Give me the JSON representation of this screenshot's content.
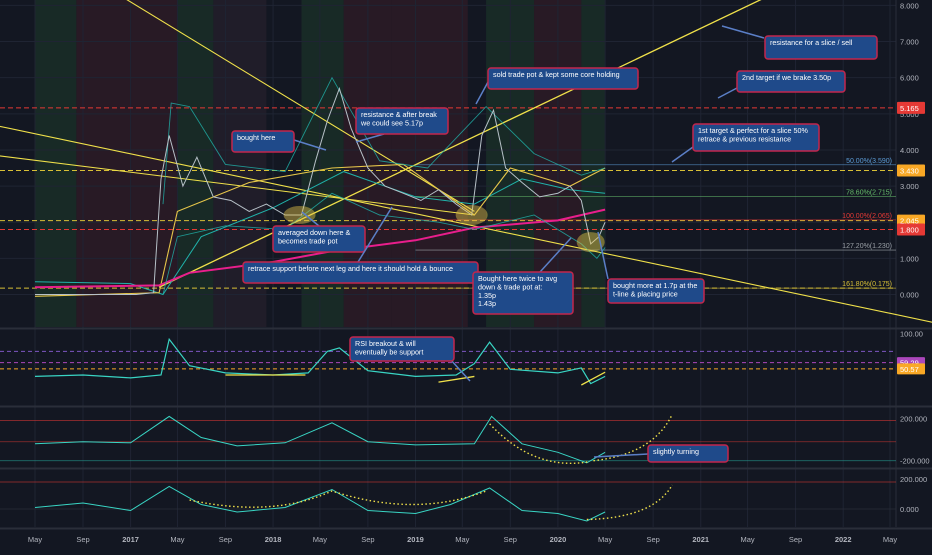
{
  "colors": {
    "background": "#131722",
    "grid": "#1f2433",
    "axis_text": "#b2b5be",
    "price_line": "#b7c1c8",
    "bollinger": "#20b2aa",
    "ma_fast": "#e6c64a",
    "ma_slow": "#e91e8c",
    "trendline": "#f0e14a",
    "level_line": "#d8c036",
    "red_level": "#e53935",
    "note_fill": "#1f4a8a",
    "note_border": "#c3264c",
    "note_text": "#ffffff",
    "oscillator": "#39d5c4",
    "hist_up": "#26a69a",
    "hist_down": "#ef5350"
  },
  "chart_data": [
    {
      "type": "line",
      "panel": "price",
      "y_axis_ticks": [
        "8.000",
        "7.000",
        "6.000",
        "5.000",
        "4.000",
        "3.000",
        "2.000",
        "1.000",
        "0.000"
      ],
      "ylim": [
        -0.9,
        8.15
      ],
      "series": [
        {
          "x": [
            "2016-05-01",
            "2016-08-01",
            "2016-11-01",
            "2017-01-15",
            "2017-03-01",
            "2017-03-20",
            "2017-04-10",
            "2017-05-15",
            "2017-06-20",
            "2017-08-01",
            "2017-09-15",
            "2017-11-01",
            "2017-12-15",
            "2018-02-01",
            "2018-03-15",
            "2018-04-20",
            "2018-05-20",
            "2018-06-20",
            "2018-07-20",
            "2018-09-01",
            "2018-10-15",
            "2018-12-01",
            "2019-01-15",
            "2019-03-01",
            "2019-04-15",
            "2019-05-25",
            "2019-06-20",
            "2019-07-20",
            "2019-08-20",
            "2019-10-01",
            "2019-11-15",
            "2020-01-01",
            "2020-02-01",
            "2020-03-01",
            "2020-03-25",
            "2020-04-15",
            "2020-05-01"
          ],
          "y": [
            0.0,
            0.0,
            0.0,
            0.0,
            0.05,
            3.2,
            4.4,
            3.0,
            3.8,
            2.7,
            2.6,
            2.3,
            2.5,
            2.2,
            2.2,
            3.7,
            4.8,
            5.7,
            4.6,
            3.5,
            3.0,
            2.8,
            2.6,
            2.9,
            2.5,
            2.2,
            4.4,
            5.1,
            3.5,
            3.1,
            2.7,
            2.8,
            3.0,
            2.6,
            1.4,
            1.6,
            2.0
          ]
        }
      ],
      "horizontal_levels": [
        {
          "name": "5.165",
          "value": 5.165,
          "color": "#e53935"
        },
        {
          "name": "3.430",
          "value": 3.43,
          "color": "#d8c036"
        },
        {
          "name": "2.045",
          "value": 2.045,
          "color": "#d8c036"
        },
        {
          "name": "1.800",
          "value": 1.8,
          "color": "#e53935"
        },
        {
          "name": "0.175",
          "value": 0.175,
          "color": "#d8c036"
        }
      ],
      "price_tags": [
        {
          "label": "5.165",
          "value": 5.165,
          "color": "#e53935"
        },
        {
          "label": "3.430",
          "value": 3.43,
          "color": "#f9a825"
        },
        {
          "label": "2.045",
          "value": 2.045,
          "color": "#f9a825"
        },
        {
          "label": "1.800",
          "value": 1.8,
          "color": "#e53935"
        }
      ],
      "fib_labels": [
        {
          "label": "50.00%(3.590)",
          "value": 3.59,
          "color": "#5b9bd5"
        },
        {
          "label": "78.60%(2.715)",
          "value": 2.715,
          "color": "#66bb6a"
        },
        {
          "label": "100.00%(2.065)",
          "value": 2.065,
          "color": "#e53935"
        },
        {
          "label": "127.20%(1.230)",
          "value": 1.23,
          "color": "#9aa0a6"
        },
        {
          "label": "161.80%(0.175)",
          "value": 0.175,
          "color": "#d8c036"
        }
      ]
    },
    {
      "type": "line",
      "panel": "rsi",
      "y_axis_ticks": [
        "100.00",
        "59.29",
        "50.57"
      ],
      "tags": [
        {
          "label": "59.29",
          "value": 59.29,
          "color": "#ab47bc"
        },
        {
          "label": "50.57",
          "value": 50.57,
          "color": "#f9a825"
        }
      ],
      "ylim": [
        0,
        105
      ],
      "series": [
        {
          "x": [
            "2016-05-01",
            "2016-09-01",
            "2017-01-01",
            "2017-03-20",
            "2017-04-10",
            "2017-06-01",
            "2017-09-01",
            "2018-01-01",
            "2018-04-01",
            "2018-05-20",
            "2018-06-20",
            "2018-09-01",
            "2019-01-01",
            "2019-04-15",
            "2019-06-01",
            "2019-07-10",
            "2019-09-01",
            "2020-01-01",
            "2020-03-01",
            "2020-03-25",
            "2020-05-01"
          ],
          "y": [
            40,
            42,
            38,
            42,
            92,
            55,
            45,
            42,
            45,
            75,
            80,
            48,
            40,
            42,
            58,
            88,
            50,
            45,
            52,
            30,
            40
          ]
        }
      ]
    },
    {
      "type": "bar",
      "panel": "momentum",
      "y_axis_ticks": [
        "200.000",
        "-200.000"
      ],
      "ylim": [
        -260,
        300
      ]
    },
    {
      "type": "area",
      "panel": "oscillator",
      "y_axis_ticks": [
        "200.000",
        "0.000"
      ],
      "ylim": [
        -120,
        260
      ]
    }
  ],
  "x_axis": {
    "ticks": [
      {
        "label": "May",
        "date": "2016-05-01"
      },
      {
        "label": "Sep",
        "date": "2016-09-01"
      },
      {
        "label": "2017",
        "date": "2017-01-01"
      },
      {
        "label": "May",
        "date": "2017-05-01"
      },
      {
        "label": "Sep",
        "date": "2017-09-01"
      },
      {
        "label": "2018",
        "date": "2018-01-01"
      },
      {
        "label": "May",
        "date": "2018-05-01"
      },
      {
        "label": "Sep",
        "date": "2018-09-01"
      },
      {
        "label": "2019",
        "date": "2019-01-01"
      },
      {
        "label": "May",
        "date": "2019-05-01"
      },
      {
        "label": "Sep",
        "date": "2019-09-01"
      },
      {
        "label": "2020",
        "date": "2020-01-01"
      },
      {
        "label": "May",
        "date": "2020-05-01"
      },
      {
        "label": "Sep",
        "date": "2020-09-01"
      },
      {
        "label": "2021",
        "date": "2021-01-01"
      },
      {
        "label": "May",
        "date": "2021-05-01"
      },
      {
        "label": "Sep",
        "date": "2021-09-01"
      },
      {
        "label": "2022",
        "date": "2022-01-01"
      },
      {
        "label": "May",
        "date": "2022-05-01"
      }
    ]
  },
  "annotations": [
    {
      "id": "resistance-slice",
      "text": [
        "resistance for a slice / sell"
      ]
    },
    {
      "id": "sold-trade-pot",
      "text": [
        "sold trade pot & kept some core holding"
      ]
    },
    {
      "id": "second-target",
      "text": [
        "2nd target if we brake 3.50p"
      ]
    },
    {
      "id": "resistance-break",
      "text": [
        "resistance & after break",
        "we could see 5.17p"
      ]
    },
    {
      "id": "bought-here",
      "text": [
        "bought here"
      ]
    },
    {
      "id": "first-target",
      "text": [
        "1st target & perfect for a slice 50%",
        "retrace & previous resistance"
      ]
    },
    {
      "id": "averaged-down",
      "text": [
        "averaged down here &",
        "becomes trade pot"
      ]
    },
    {
      "id": "retrace-support",
      "text": [
        "retrace support before next leg and here it should hold & bounce"
      ]
    },
    {
      "id": "bought-twice",
      "text": [
        "Bought here twice to avg",
        "down & trade pot at:",
        "1.35p",
        "1.43p"
      ]
    },
    {
      "id": "bought-more",
      "text": [
        "bought more at 1.7p at the",
        "t-line & placing price"
      ]
    },
    {
      "id": "rsi-breakout",
      "text": [
        "RSI breakout & will",
        "eventually be support"
      ]
    },
    {
      "id": "slightly-turning",
      "text": [
        "slightly turning"
      ]
    }
  ]
}
